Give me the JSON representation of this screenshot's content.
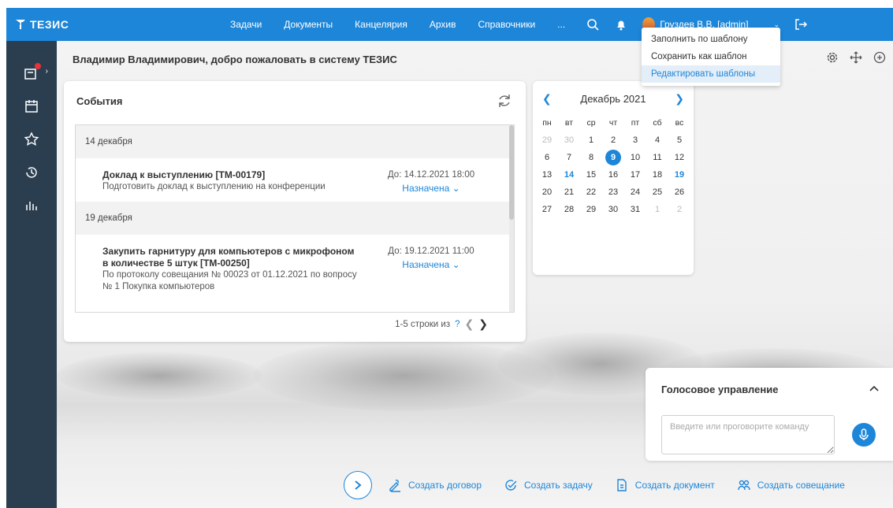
{
  "app": {
    "name": "ТЕЗИС"
  },
  "nav": {
    "items": [
      {
        "label": "Задачи"
      },
      {
        "label": "Документы"
      },
      {
        "label": "Канцелярия"
      },
      {
        "label": "Архив"
      },
      {
        "label": "Справочники"
      },
      {
        "label": "..."
      }
    ]
  },
  "user": {
    "name": "Груздев В.В. [admin]"
  },
  "welcome": "Владимир Владимирович, добро пожаловать в систему ТЕЗИС",
  "events": {
    "title": "События",
    "groups": [
      {
        "date": "14 декабря",
        "items": [
          {
            "title": "Доклад к выступлению [ТМ-00179]",
            "desc": "Подготовить доклад к выступлению на конференции",
            "due": "До: 14.12.2021 18:00",
            "status": "Назначена"
          }
        ]
      },
      {
        "date": "19 декабря",
        "items": [
          {
            "title": "Закупить гарнитуру для компьютеров с микрофоном в количестве 5 штук [ТМ-00250]",
            "desc": "По протоколу совещания № 00023 от 01.12.2021 по вопросу № 1 Покупка компьютеров",
            "due": "До: 19.12.2021 11:00",
            "status": "Назначена"
          }
        ]
      }
    ],
    "pager": {
      "text": "1-5 строки из",
      "total": "?"
    }
  },
  "calendar": {
    "month": "Декабрь 2021",
    "weekdays": [
      "пн",
      "вт",
      "ср",
      "чт",
      "пт",
      "сб",
      "вс"
    ],
    "weeks": [
      [
        "29",
        "30",
        "1",
        "2",
        "3",
        "4",
        "5"
      ],
      [
        "6",
        "7",
        "8",
        "9",
        "10",
        "11",
        "12"
      ],
      [
        "13",
        "14",
        "15",
        "16",
        "17",
        "18",
        "19"
      ],
      [
        "20",
        "21",
        "22",
        "23",
        "24",
        "25",
        "26"
      ],
      [
        "27",
        "28",
        "29",
        "30",
        "31",
        "1",
        "2"
      ]
    ],
    "today": "9",
    "highlighted": [
      "14",
      "19"
    ]
  },
  "template_menu": {
    "items": [
      {
        "label": "Заполнить по шаблону",
        "active": false
      },
      {
        "label": "Сохранить как шаблон",
        "active": false
      },
      {
        "label": "Редактировать шаблоны",
        "active": true
      }
    ]
  },
  "voice": {
    "title": "Голосовое управление",
    "placeholder": "Введите или проговорите команду"
  },
  "quick_actions": [
    {
      "label": "Создать договор",
      "icon": "contract-icon"
    },
    {
      "label": "Создать задачу",
      "icon": "task-check-icon"
    },
    {
      "label": "Создать документ",
      "icon": "document-icon"
    },
    {
      "label": "Создать совещание",
      "icon": "meeting-icon"
    }
  ],
  "colors": {
    "accent": "#1e86d8",
    "sidebar": "#2b3e50",
    "badge": "#e8333a"
  }
}
